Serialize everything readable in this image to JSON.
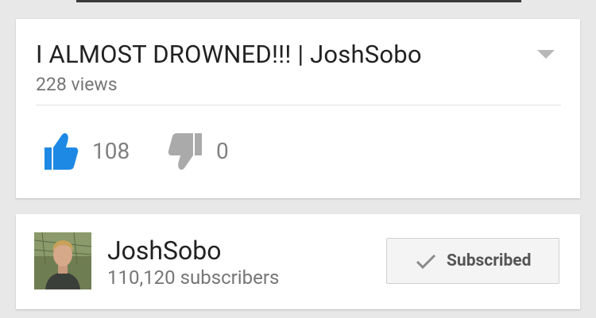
{
  "video": {
    "title": "I ALMOST DROWNED!!! | JoshSobo",
    "views": "228 views",
    "likes": "108",
    "dislikes": "0"
  },
  "channel": {
    "name": "JoshSobo",
    "subscribers": "110,120 subscribers",
    "subscribe_label": "Subscribed"
  },
  "colors": {
    "like_active": "#1e88e5",
    "dislike_inactive": "#aaaaaa"
  },
  "icons": {
    "like": "thumbs-up-icon",
    "dislike": "thumbs-down-icon",
    "menu": "dropdown-arrow-icon",
    "subscribed": "checkmark-icon"
  }
}
